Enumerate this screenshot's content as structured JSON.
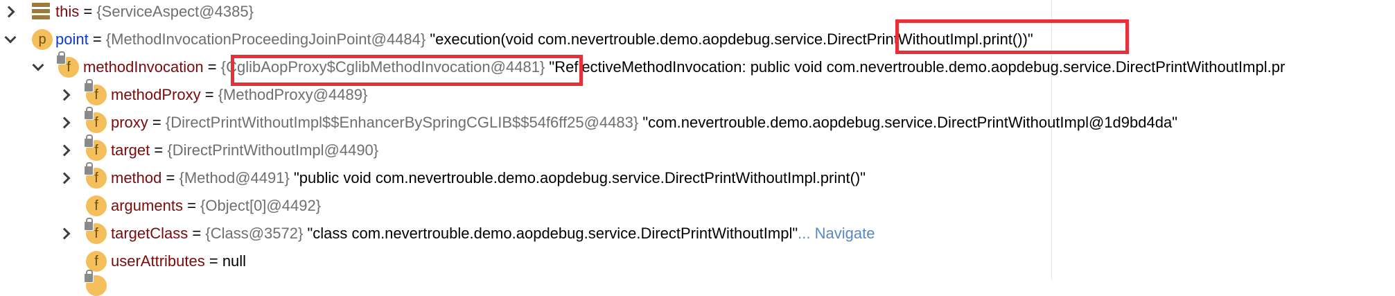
{
  "rows": {
    "this": {
      "name": "this",
      "eq": " = ",
      "type": "{ServiceAspect@4385}"
    },
    "point": {
      "icon_letter": "p",
      "name": "point",
      "eq": " = ",
      "type": "{MethodInvocationProceedingJoinPoint@4484}",
      "value_prefix": " \"execution(void com.nevertrouble.demo.aopdebug.service.",
      "value_highlighted": "DirectPrintWithoutImpl.print())",
      "value_suffix": "\""
    },
    "methodInvocation": {
      "icon_letter": "f",
      "name": "methodInvocation",
      "eq": " = ",
      "type": "{CglibAopProxy$CglibMethodInvocation@4481}",
      "value": " \"ReflectiveMethodInvocation: public void com.nevertrouble.demo.aopdebug.service.DirectPrintWithoutImpl.pr"
    },
    "methodProxy": {
      "icon_letter": "f",
      "name": "methodProxy",
      "eq": " = ",
      "type": "{MethodProxy@4489}"
    },
    "proxy": {
      "icon_letter": "f",
      "name": "proxy",
      "eq": " = ",
      "type": "{DirectPrintWithoutImpl$$EnhancerBySpringCGLIB$$54f6ff25@4483}",
      "value": " \"com.nevertrouble.demo.aopdebug.service.DirectPrintWithoutImpl@1d9bd4da\""
    },
    "target": {
      "icon_letter": "f",
      "name": "target",
      "eq": " = ",
      "type": "{DirectPrintWithoutImpl@4490}"
    },
    "method": {
      "icon_letter": "f",
      "name": "method",
      "eq": " = ",
      "type": "{Method@4491}",
      "value": " \"public void com.nevertrouble.demo.aopdebug.service.DirectPrintWithoutImpl.print()\""
    },
    "arguments": {
      "icon_letter": "f",
      "name": "arguments",
      "eq": " = ",
      "type": "{Object[0]@4492}"
    },
    "targetClass": {
      "icon_letter": "f",
      "name": "targetClass",
      "eq": " = ",
      "type": "{Class@3572}",
      "value": " \"class com.nevertrouble.demo.aopdebug.service.DirectPrintWithoutImpl\"",
      "link": "... Navigate"
    },
    "userAttributes": {
      "icon_letter": "f",
      "name": "userAttributes",
      "eq": " = ",
      "value": "null"
    }
  },
  "colors": {
    "highlight_border": "#e8303a",
    "field_name": "#7b0a0a",
    "param_name": "#0b38d1",
    "type_text": "#6f6f6f",
    "link": "#5a87c5",
    "icon_fill": "#f4bf5b"
  }
}
